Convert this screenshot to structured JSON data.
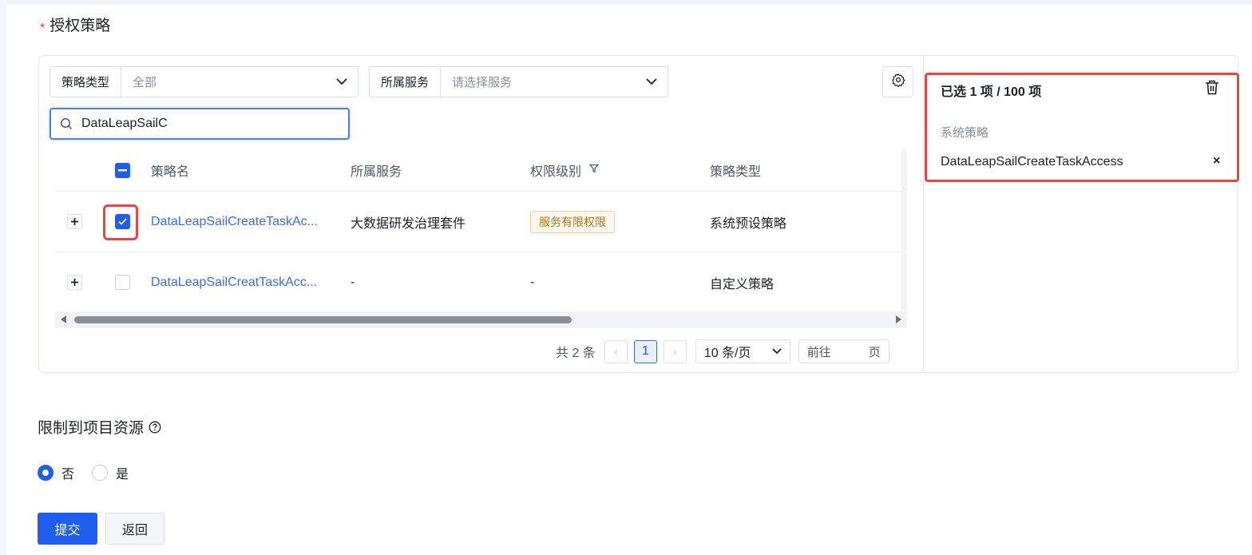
{
  "section": {
    "required_mark": "*",
    "title": "授权策略"
  },
  "filters": {
    "policy_type_label": "策略类型",
    "policy_type_value": "全部",
    "service_label": "所属服务",
    "service_placeholder": "请选择服务"
  },
  "search": {
    "value": "DataLeapSailC"
  },
  "table": {
    "headers": {
      "name": "策略名",
      "service": "所属服务",
      "level": "权限级别",
      "type": "策略类型"
    },
    "rows": [
      {
        "name": "DataLeapSailCreateTaskAc...",
        "service": "大数据研发治理套件",
        "level": "服务有限权限",
        "type": "系统预设策略",
        "checked": true
      },
      {
        "name": "DataLeapSailCreatTaskAcc...",
        "service": "-",
        "level": "-",
        "type": "自定义策略",
        "checked": false
      }
    ]
  },
  "pagination": {
    "total": "共 2 条",
    "current_page": "1",
    "page_size": "10 条/页",
    "goto_prefix": "前往",
    "goto_suffix": "页"
  },
  "selected": {
    "header": "已选 1 项 / 100 项",
    "category": "系统策略",
    "item": "DataLeapSailCreateTaskAccess",
    "remove": "×"
  },
  "limit": {
    "title": "限制到项目资源",
    "option_no": "否",
    "option_yes": "是",
    "selected": "否"
  },
  "actions": {
    "submit": "提交",
    "back": "返回"
  },
  "colors": {
    "primary": "#1f5ef0",
    "link": "#3a6ee8",
    "highlight": "#e84545",
    "tag_text": "#b07519"
  }
}
